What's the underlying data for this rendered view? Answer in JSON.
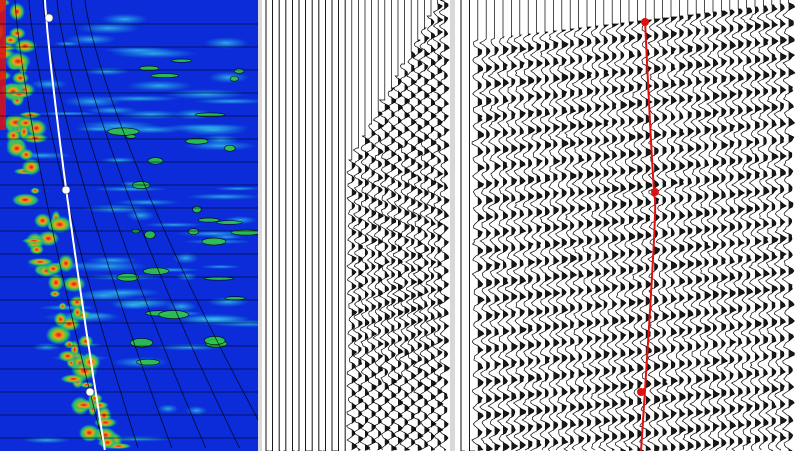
{
  "panels": {
    "semblance": {
      "name": "velocity-semblance-panel",
      "colors": {
        "low": "#0b2cd8",
        "mid": "#1aa0e0",
        "high": "#2ec84a",
        "peak": "#f0a020",
        "max": "#e01010",
        "picks": "#ffffff"
      }
    },
    "gather": {
      "name": "cmp-gather-panel",
      "colors": {
        "trace": "#000000"
      }
    },
    "nmo": {
      "name": "nmo-corrected-gather-panel",
      "colors": {
        "trace": "#000000",
        "pick_line": "#e01010"
      }
    }
  },
  "velocity_picks": [
    {
      "id": "pick-1"
    },
    {
      "id": "pick-2"
    },
    {
      "id": "pick-3"
    }
  ]
}
